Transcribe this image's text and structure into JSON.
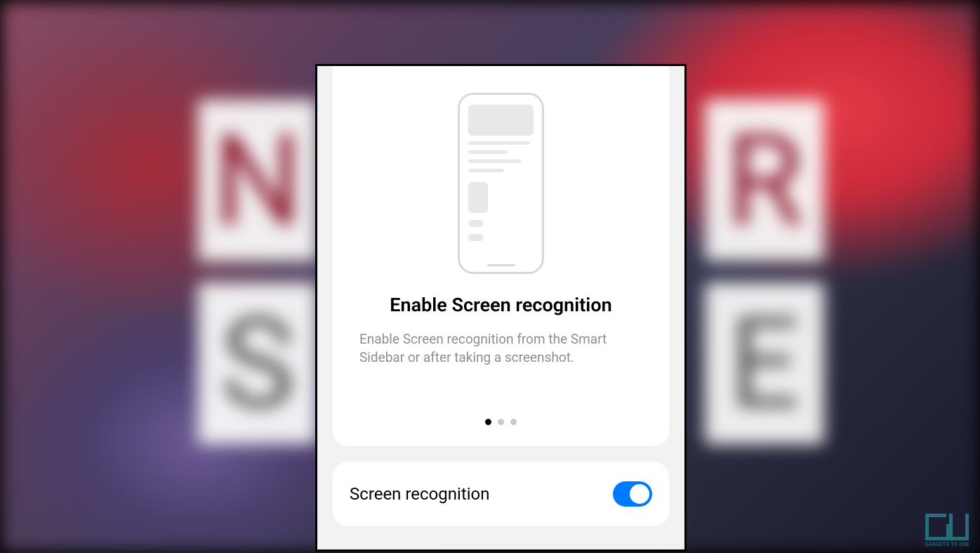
{
  "onboarding": {
    "title": "Enable Screen recognition",
    "description": "Enable Screen recognition from the Smart Sidebar or after taking a screenshot.",
    "dots": {
      "count": 3,
      "activeIndex": 0
    }
  },
  "toggle": {
    "label": "Screen recognition",
    "state": "on",
    "color": "#007aff"
  },
  "background": {
    "letters": [
      "N",
      "S",
      "R",
      "E"
    ]
  },
  "watermark": {
    "text": "GADGETS TO USE"
  }
}
